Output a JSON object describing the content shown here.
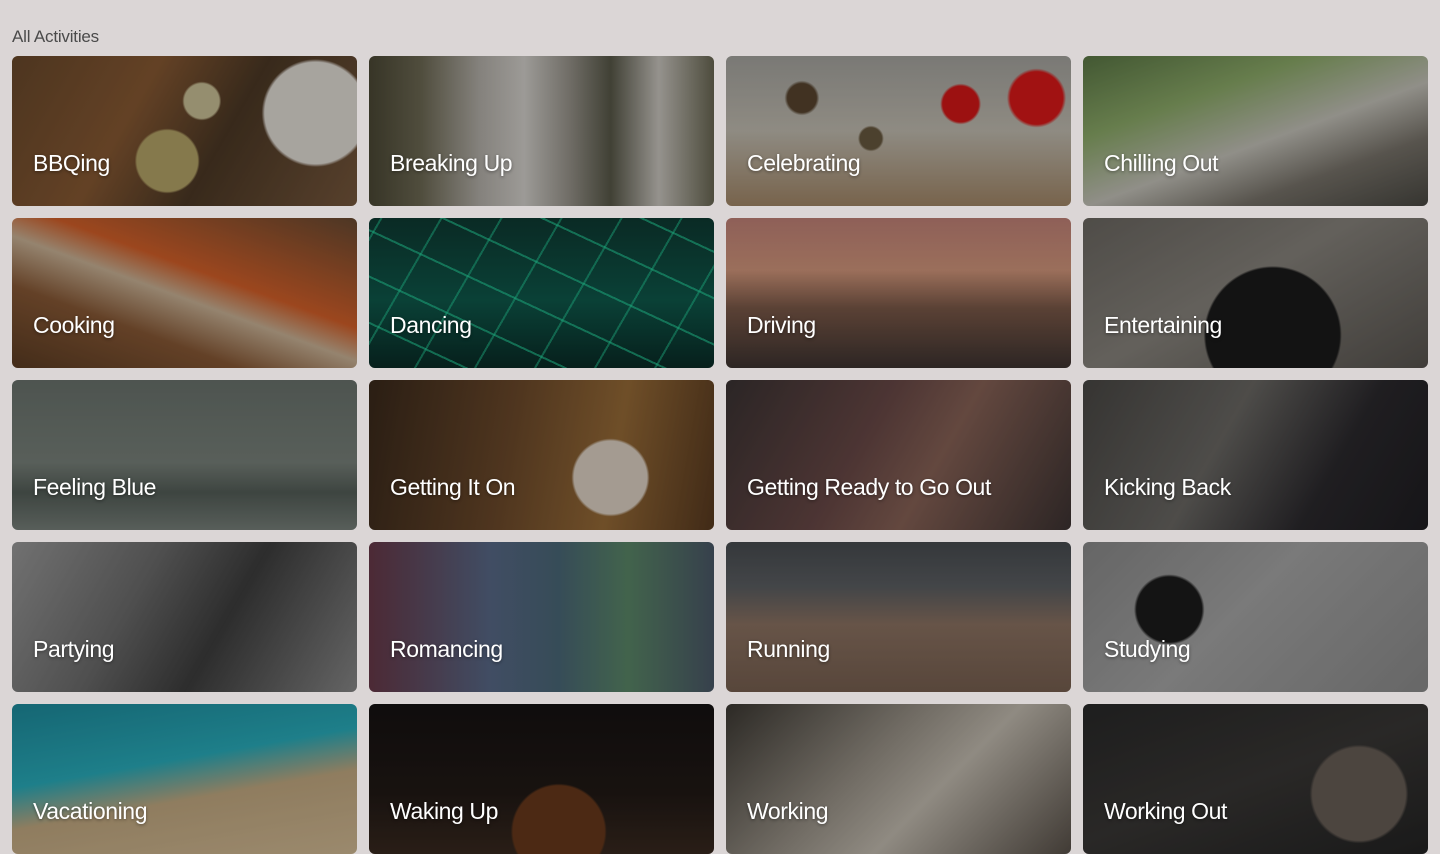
{
  "section_title": "All Activities",
  "activities": [
    {
      "label": "BBQing"
    },
    {
      "label": "Breaking Up"
    },
    {
      "label": "Celebrating"
    },
    {
      "label": "Chilling Out"
    },
    {
      "label": "Cooking"
    },
    {
      "label": "Dancing"
    },
    {
      "label": "Driving"
    },
    {
      "label": "Entertaining"
    },
    {
      "label": "Feeling Blue"
    },
    {
      "label": "Getting It On"
    },
    {
      "label": "Getting Ready to Go Out"
    },
    {
      "label": "Kicking Back"
    },
    {
      "label": "Partying"
    },
    {
      "label": "Romancing"
    },
    {
      "label": "Running"
    },
    {
      "label": "Studying"
    },
    {
      "label": "Vacationing"
    },
    {
      "label": "Waking Up"
    },
    {
      "label": "Working"
    },
    {
      "label": "Working Out"
    }
  ]
}
